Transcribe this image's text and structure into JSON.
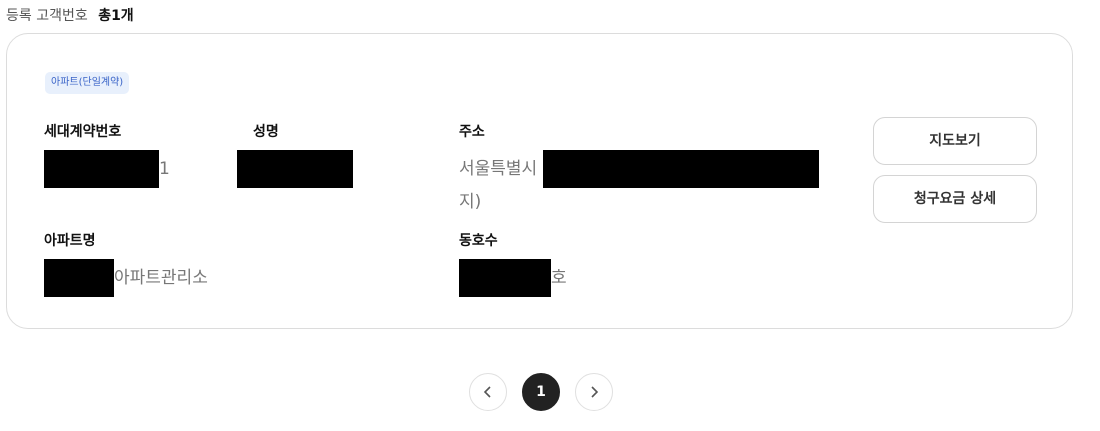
{
  "summary": {
    "label": "등록 고객번호",
    "count": "총1개"
  },
  "card": {
    "type_badge": "아파트(단일계약)",
    "household_contract_no": {
      "label": "세대계약번호",
      "value_suffix": "1"
    },
    "name": {
      "label": "성명"
    },
    "address": {
      "label": "주소",
      "value_prefix": "서울특별시",
      "value_line2": "지)"
    },
    "apartment_name": {
      "label": "아파트명",
      "value_suffix": "아파트관리소"
    },
    "unit_no": {
      "label": "동호수",
      "value_suffix": "호"
    },
    "buttons": {
      "map": "지도보기",
      "bill_detail": "청구요금 상세"
    }
  },
  "pagination": {
    "current_page": "1",
    "prev_icon": "chevron-left-icon",
    "next_icon": "chevron-right-icon"
  }
}
